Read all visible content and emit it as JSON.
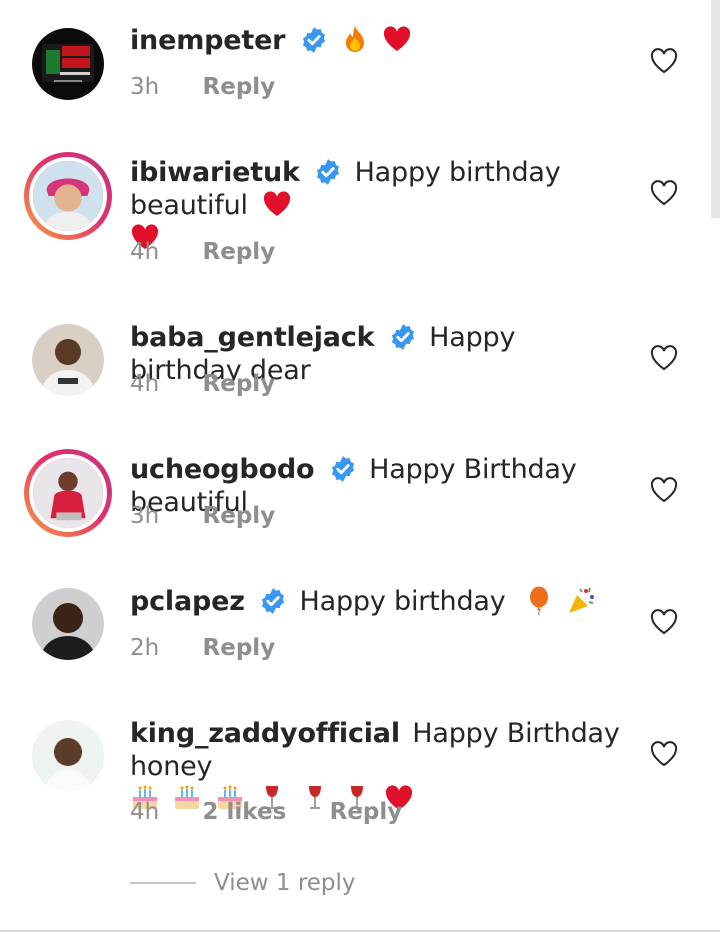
{
  "comments": [
    {
      "username": "inempeter",
      "text": "",
      "text2": "",
      "emojis_inline": [
        "fire",
        "red-heart"
      ],
      "time": "3h",
      "likes": "",
      "reply": "Reply",
      "avatar_logo_text": "BLACK TUESDAY"
    },
    {
      "username": "ibiwarietuk",
      "text": "Happy birthday beautiful",
      "emojis_inline": [
        "red-heart"
      ],
      "emojis_line2": [
        "red-heart"
      ],
      "time": "4h",
      "likes": "",
      "reply": "Reply"
    },
    {
      "username": "baba_gentlejack",
      "text": "Happy birthday dear",
      "time": "4h",
      "likes": "",
      "reply": "Reply"
    },
    {
      "username": "ucheogbodo",
      "text": "Happy Birthday beautiful",
      "time": "3h",
      "likes": "",
      "reply": "Reply"
    },
    {
      "username": "pclapez",
      "text": "Happy birthday",
      "emojis_inline": [
        "balloon",
        "party-popper"
      ],
      "time": "2h",
      "likes": "",
      "reply": "Reply"
    },
    {
      "username": "king_zaddyofficial",
      "text": "Happy Birthday honey",
      "emojis_line2": [
        "birthday-cake",
        "birthday-cake",
        "birthday-cake",
        "wine-glass",
        "wine-glass",
        "wine-glass",
        "red-heart"
      ],
      "time": "4h",
      "likes": "2 likes",
      "reply": "Reply"
    }
  ],
  "view_replies": "View 1 reply",
  "colors": {
    "verified": "#3897f0",
    "muted": "#8e8e8e",
    "heart": "#e0102a"
  }
}
